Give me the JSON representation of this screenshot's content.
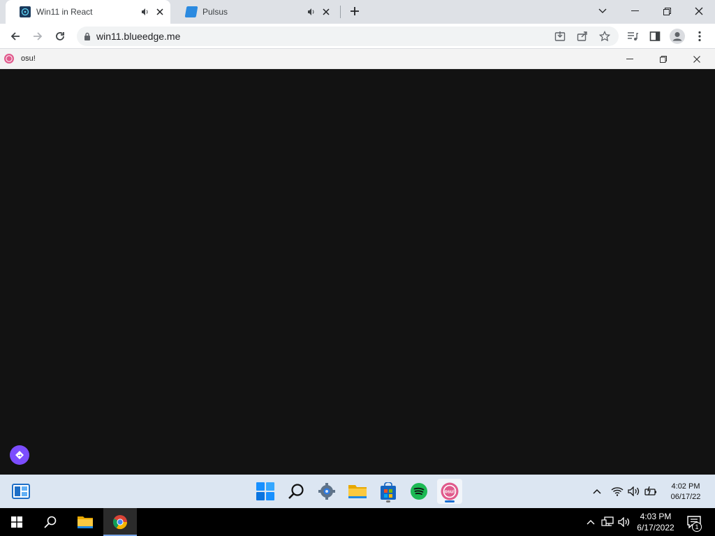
{
  "browser": {
    "tabs": [
      {
        "title": "Win11 in React",
        "favicon": "win11-react-icon",
        "active": true,
        "audio": true
      },
      {
        "title": "Pulsus",
        "favicon": "pulsus-icon",
        "active": false,
        "audio": true
      }
    ],
    "new_tab_icon": "plus-icon",
    "address": "win11.blueedge.me",
    "toolbar_icons": [
      "back-icon",
      "forward-icon",
      "reload-icon",
      "lock-icon",
      "install-icon",
      "share-icon",
      "star-icon",
      "media-icon",
      "side-panel-icon",
      "profile-icon",
      "menu-icon"
    ]
  },
  "osu_window": {
    "title": "osu!",
    "canvas_color": "#121212"
  },
  "web_taskbar": {
    "apps": [
      "widgets-icon",
      "start-icon",
      "search-icon",
      "settings-icon",
      "file-explorer-icon",
      "store-icon",
      "spotify-icon",
      "osu-icon"
    ],
    "time": "4:02 PM",
    "date": "06/17/22"
  },
  "host_taskbar": {
    "time": "4:03 PM",
    "date": "6/17/2022",
    "notification_count": "1"
  },
  "colors": {
    "accent_purple": "#7c4dff",
    "osu_pink": "#e05a8c",
    "spotify_green": "#1db954"
  }
}
